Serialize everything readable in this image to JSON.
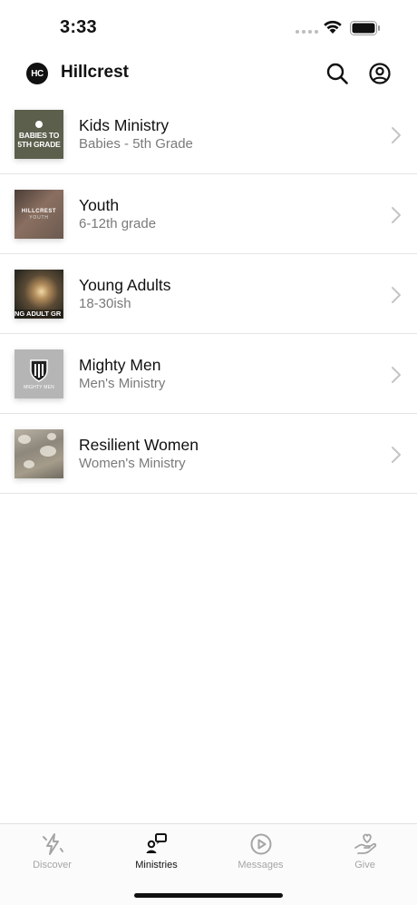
{
  "status_bar": {
    "time": "3:33"
  },
  "header": {
    "logo_text": "HC",
    "title": "Hillcrest"
  },
  "ministries": [
    {
      "title": "Kids Ministry",
      "subtitle": "Babies - 5th Grade",
      "thumb_line1": "BABIES TO",
      "thumb_line2": "5TH GRADE"
    },
    {
      "title": "Youth",
      "subtitle": "6-12th grade",
      "thumb_line1": "HILLCREST",
      "thumb_line2": "YOUTH"
    },
    {
      "title": "Young Adults",
      "subtitle": "18-30ish",
      "thumb_line1": "NG ADULT GR"
    },
    {
      "title": "Mighty Men",
      "subtitle": "Men's Ministry",
      "thumb_line1": "MIGHTY MEN"
    },
    {
      "title": "Resilient Women",
      "subtitle": "Women's Ministry"
    }
  ],
  "tabs": [
    {
      "label": "Discover",
      "icon": "sparkle-bolt-icon"
    },
    {
      "label": "Ministries",
      "icon": "people-chat-icon"
    },
    {
      "label": "Messages",
      "icon": "play-circle-icon"
    },
    {
      "label": "Give",
      "icon": "heart-hand-icon"
    }
  ],
  "active_tab": "Ministries",
  "colors": {
    "accent": "#111111",
    "inactive": "#a5a5a5",
    "subtitle": "#7a7a7a"
  }
}
